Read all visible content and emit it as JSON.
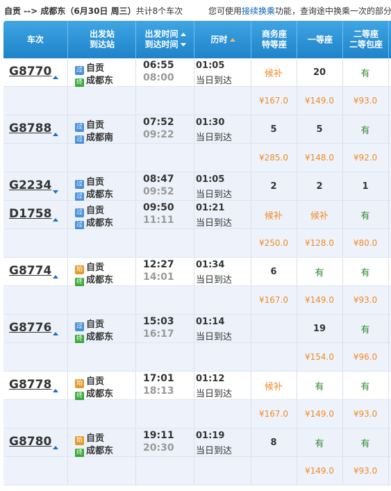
{
  "header_bar": {
    "route": "自贡 --> 成都东（6月30日  周三）",
    "count": "共计8个车次",
    "note_prefix": "您可使用",
    "note_link": "接续换乘",
    "note_suffix": "功能，查询途中换乘一次的部分列车余票情况。"
  },
  "columns": {
    "train": "车次",
    "stations_1": "出发站",
    "stations_2": "到达站",
    "times_1": "出发时间",
    "times_2": "到达时间",
    "duration": "历时",
    "business_1": "商务座",
    "business_2": "特等座",
    "first": "一等座",
    "second_1": "二等座",
    "second_2": "二等包座"
  },
  "trains": [
    {
      "no": "G8770",
      "from_tag": "过",
      "from": "自贡",
      "to_tag": "终",
      "to": "成都东",
      "dep": "06:55",
      "arr": "08:00",
      "dur": "01:05",
      "day": "当日到达",
      "business": "候补",
      "first": "20",
      "second": "有",
      "prices": {
        "business": "¥167.0",
        "first": "¥149.0",
        "second": "¥93.0"
      }
    },
    {
      "no": "G8788",
      "from_tag": "过",
      "from": "自贡",
      "to_tag": "过",
      "to": "成都南",
      "dep": "07:52",
      "arr": "09:22",
      "dur": "01:30",
      "day": "当日到达",
      "business": "5",
      "first": "5",
      "second": "有",
      "prices": {
        "business": "¥285.0",
        "first": "¥148.0",
        "second": "¥92.0"
      }
    },
    {
      "no": "G2234",
      "from_tag": "过",
      "from": "自贡",
      "to_tag": "过",
      "to": "成都东",
      "dep": "08:47",
      "arr": "09:52",
      "dur": "01:05",
      "day": "当日到达",
      "business": "2",
      "first": "2",
      "second": "1",
      "prices": null
    },
    {
      "no": "D1758",
      "from_tag": "过",
      "from": "自贡",
      "to_tag": "过",
      "to": "成都东",
      "dep": "09:50",
      "arr": "11:11",
      "dur": "01:21",
      "day": "当日到达",
      "business": "候补",
      "first": "候补",
      "second": "有",
      "prices": {
        "business": "¥250.0",
        "first": "¥128.0",
        "second": "¥80.0"
      }
    },
    {
      "no": "G8774",
      "from_tag": "始",
      "from": "自贡",
      "to_tag": "终",
      "to": "成都东",
      "dep": "12:27",
      "arr": "14:01",
      "dur": "01:34",
      "day": "当日到达",
      "business": "6",
      "first": "有",
      "second": "有",
      "prices": {
        "business": "¥167.0",
        "first": "¥149.0",
        "second": "¥93.0"
      }
    },
    {
      "no": "G8776",
      "from_tag": "过",
      "from": "自贡",
      "to_tag": "终",
      "to": "成都东",
      "dep": "15:03",
      "arr": "16:17",
      "dur": "01:14",
      "day": "当日到达",
      "business": "",
      "first": "19",
      "second": "有",
      "prices": {
        "business": "",
        "first": "¥154.0",
        "second": "¥96.0"
      }
    },
    {
      "no": "G8778",
      "from_tag": "始",
      "from": "自贡",
      "to_tag": "终",
      "to": "成都东",
      "dep": "17:01",
      "arr": "18:13",
      "dur": "01:12",
      "day": "当日到达",
      "business": "候补",
      "first": "有",
      "second": "有",
      "prices": {
        "business": "¥167.0",
        "first": "¥149.0",
        "second": "¥93.0"
      }
    },
    {
      "no": "G8780",
      "from_tag": "始",
      "from": "自贡",
      "to_tag": "终",
      "to": "成都东",
      "dep": "19:11",
      "arr": "20:30",
      "dur": "01:19",
      "day": "当日到达",
      "business": "8",
      "first": "有",
      "second": "有",
      "prices": {
        "business": "",
        "first": "¥149.0",
        "second": "¥93.0"
      }
    }
  ],
  "colors": {
    "header_blue": "#1e83c9",
    "available_green": "#2e8b2e",
    "waitlist_orange": "#ee8b2c",
    "price_orange": "#f08a24"
  }
}
